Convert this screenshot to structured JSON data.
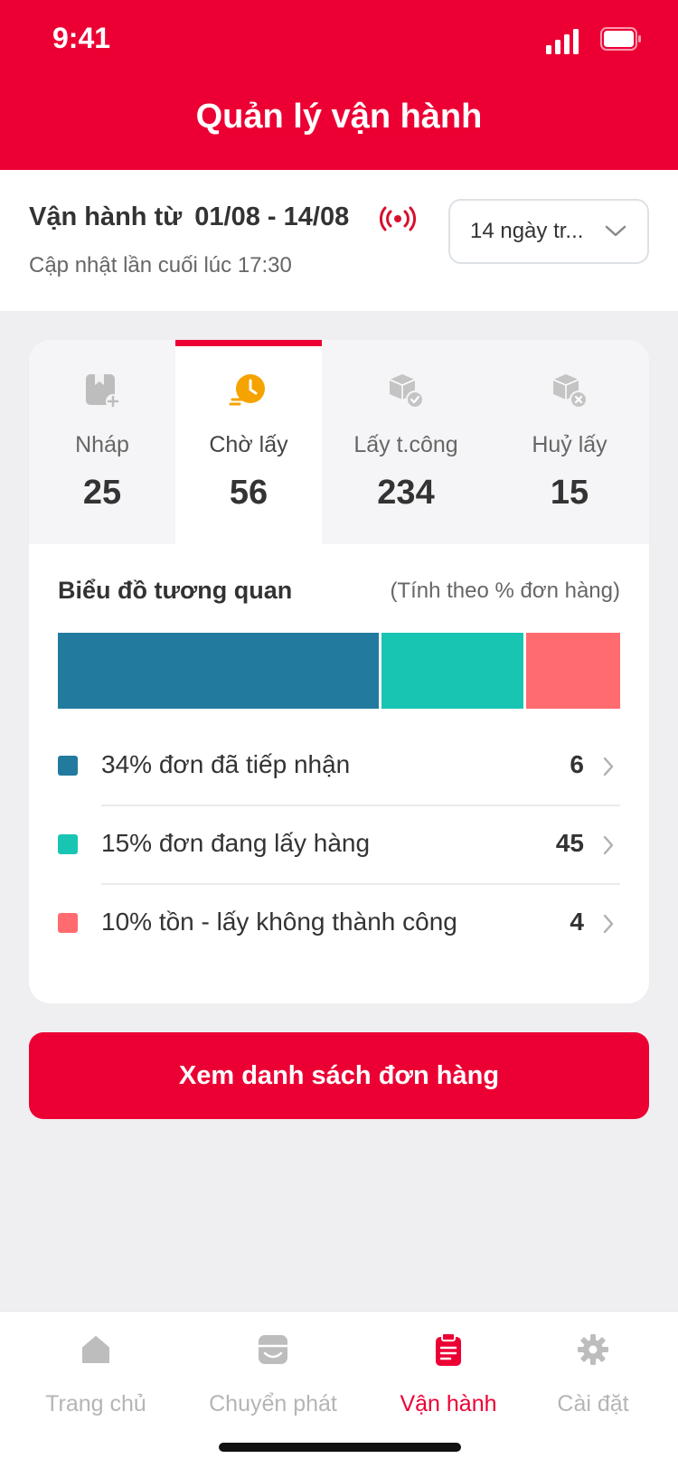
{
  "status_bar": {
    "time": "9:41"
  },
  "header": {
    "title": "Quản lý vận hành"
  },
  "filter": {
    "range_prefix": "Vận hành từ",
    "range_dates": "01/08 - 14/08",
    "updated_text": "Cập nhật lần cuối lúc 17:30",
    "select_value": "14 ngày tr..."
  },
  "tabs": [
    {
      "label": "Nháp",
      "count": "25",
      "icon": "draft-icon",
      "active": false
    },
    {
      "label": "Chờ lấy",
      "count": "56",
      "icon": "clock-icon",
      "active": true
    },
    {
      "label": "Lấy t.công",
      "count": "234",
      "icon": "box-check-icon",
      "active": false
    },
    {
      "label": "Huỷ lấy",
      "count": "15",
      "icon": "box-cancel-icon",
      "active": false
    }
  ],
  "chart": {
    "title": "Biểu đồ tương quan",
    "note": "(Tính theo % đơn hàng)"
  },
  "chart_data": {
    "type": "bar",
    "orientation": "horizontal-stacked",
    "categories": [
      "đơn đã tiếp nhận",
      "đơn đang lấy hàng",
      "tồn - lấy không thành công"
    ],
    "series": [
      {
        "values": [
          34,
          15,
          10
        ]
      }
    ],
    "colors": [
      "#227A9E",
      "#18C5B3",
      "#FF6B6F"
    ]
  },
  "legend": [
    {
      "text": "34% đơn đã tiếp nhận",
      "value": "6",
      "color": "#227A9E"
    },
    {
      "text": "15% đơn đang lấy hàng",
      "value": "45",
      "color": "#18C5B3"
    },
    {
      "text": "10% tồn - lấy không thành công",
      "value": "4",
      "color": "#FF6B6F"
    }
  ],
  "cta": {
    "label": "Xem danh sách đơn hàng"
  },
  "nav": [
    {
      "label": "Trang chủ",
      "icon": "home-icon",
      "active": false
    },
    {
      "label": "Chuyển phát",
      "icon": "store-icon",
      "active": false
    },
    {
      "label": "Vận hành",
      "icon": "clipboard-icon",
      "active": true
    },
    {
      "label": "Cài đặt",
      "icon": "gear-icon",
      "active": false
    }
  ],
  "colors": {
    "brand": "#EC0034",
    "muted": "#B5B5B5",
    "accent_orange": "#F5A300"
  }
}
